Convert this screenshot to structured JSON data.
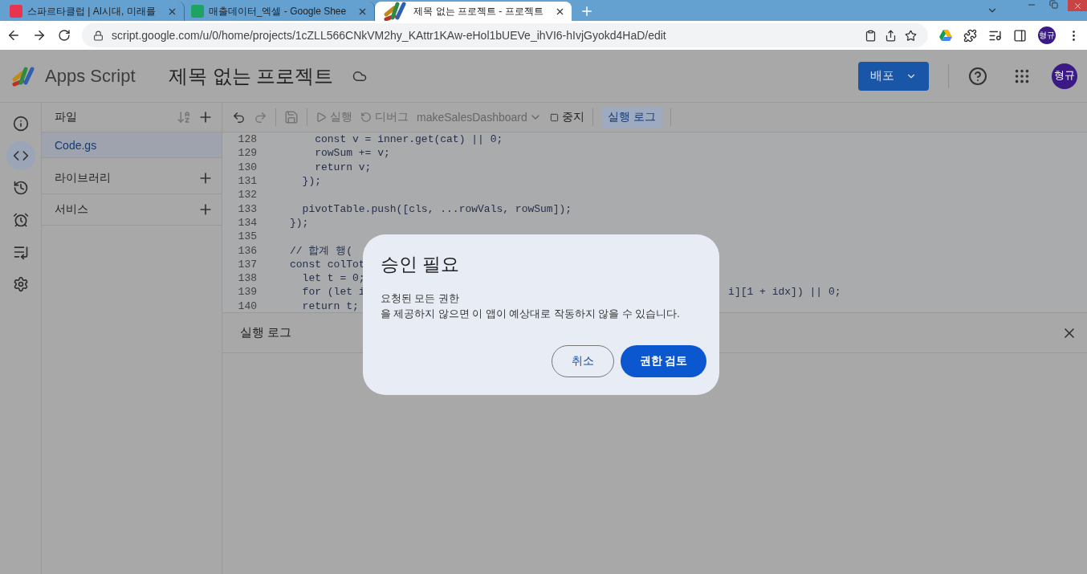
{
  "browser": {
    "tabs": [
      {
        "title": "스파르타클럽 | AI시대, 미래를",
        "kind": "sparta",
        "selected": false
      },
      {
        "title": "매출데이터_엑셀 - Google Shee",
        "kind": "sheets",
        "selected": false
      },
      {
        "title": "제목 없는 프로젝트 - 프로젝트",
        "kind": "script",
        "selected": true
      }
    ],
    "url": "script.google.com/u/0/home/projects/1cZLL566CNkVM2hy_KAttr1KAw-eHol1bUEVe_ihVI6-hIvjGyokd4HaD/edit",
    "profile": "형규"
  },
  "app": {
    "name": "Apps Script",
    "project_title": "제목 없는 프로젝트",
    "deploy_label": "배포",
    "avatar": "형규"
  },
  "rail": [
    {
      "kind": "info",
      "selected": false
    },
    {
      "kind": "editor",
      "selected": true
    },
    {
      "kind": "history",
      "selected": false
    },
    {
      "kind": "triggers",
      "selected": false
    },
    {
      "kind": "executions",
      "selected": false
    },
    {
      "kind": "settings",
      "selected": false
    }
  ],
  "files": {
    "heading": "파일",
    "items": [
      {
        "name": "Code.gs",
        "selected": true
      }
    ],
    "sections": [
      "라이브러리",
      "서비스"
    ]
  },
  "toolbar": {
    "run": "실행",
    "debug": "디버그",
    "function": "makeSalesDashboard",
    "stop": "중지",
    "log": {
      "label": "실행 로그",
      "selected": true
    }
  },
  "code": [
    {
      "number": "128",
      "text": "    const v = inner.get(cat) || 0;"
    },
    {
      "number": "129",
      "text": "    rowSum += v;"
    },
    {
      "number": "130",
      "text": "    return v;"
    },
    {
      "number": "131",
      "text": "  });"
    },
    {
      "number": "132"
    },
    {
      "number": "133",
      "text": "  pivotTable.push([cls, ...rowVals, rowSum]);"
    },
    {
      "number": "134",
      "text": "});"
    },
    {
      "number": "135"
    },
    {
      "number": "136",
      "text": "// 합계 행("
    },
    {
      "number": "137",
      "text": "const colTot"
    },
    {
      "number": "138",
      "text": "  let t = 0;"
    },
    {
      "number": "139",
      "text": "  for (let i",
      "tail": "i][1 + idx]) || 0;"
    },
    {
      "number": "140",
      "text": "  return t;"
    }
  ],
  "log_panel": {
    "title": "실행 로그"
  },
  "dialog": {
    "title": "승인 필요",
    "message_lines": [
      "요청된 모든 권한",
      "을 제공하지 않으면 이 앱이 예상대로 작동하지 않을 수 있습니다."
    ],
    "cancel": "취소",
    "confirm": "권한 검토"
  }
}
